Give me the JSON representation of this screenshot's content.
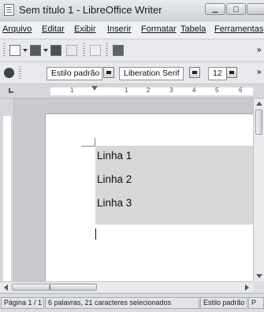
{
  "window": {
    "title": "Sem título 1 - LibreOffice Writer"
  },
  "menu": {
    "items": [
      "Arquivo",
      "Editar",
      "Exibir",
      "Inserir",
      "Formatar",
      "Tabela",
      "Ferramentas"
    ]
  },
  "formatting": {
    "paragraph_style": "Estilo padrão",
    "font_name": "Liberation Serif",
    "font_size": "12"
  },
  "ruler": {
    "numbers": [
      "1",
      "1",
      "2",
      "3",
      "4",
      "5",
      "6"
    ]
  },
  "document": {
    "lines": [
      "Linha 1",
      "Linha 2",
      "Linha 3"
    ]
  },
  "status": {
    "page": "Página 1 / 1",
    "selection_info": "6 palavras, 21 caracteres selecionados",
    "page_style": "Estilo padrão",
    "extra": "P"
  },
  "icons": {
    "app": "writer-document-icon",
    "toolbar": [
      "new-document-icon",
      "open-folder-icon",
      "save-icon",
      "export-pdf-icon",
      "edit-file-icon",
      "print-icon"
    ],
    "styles": "styles-navigator-icon"
  },
  "colors": {
    "selection": "#d6d7d9",
    "titlebar": "#d9dbdf"
  }
}
